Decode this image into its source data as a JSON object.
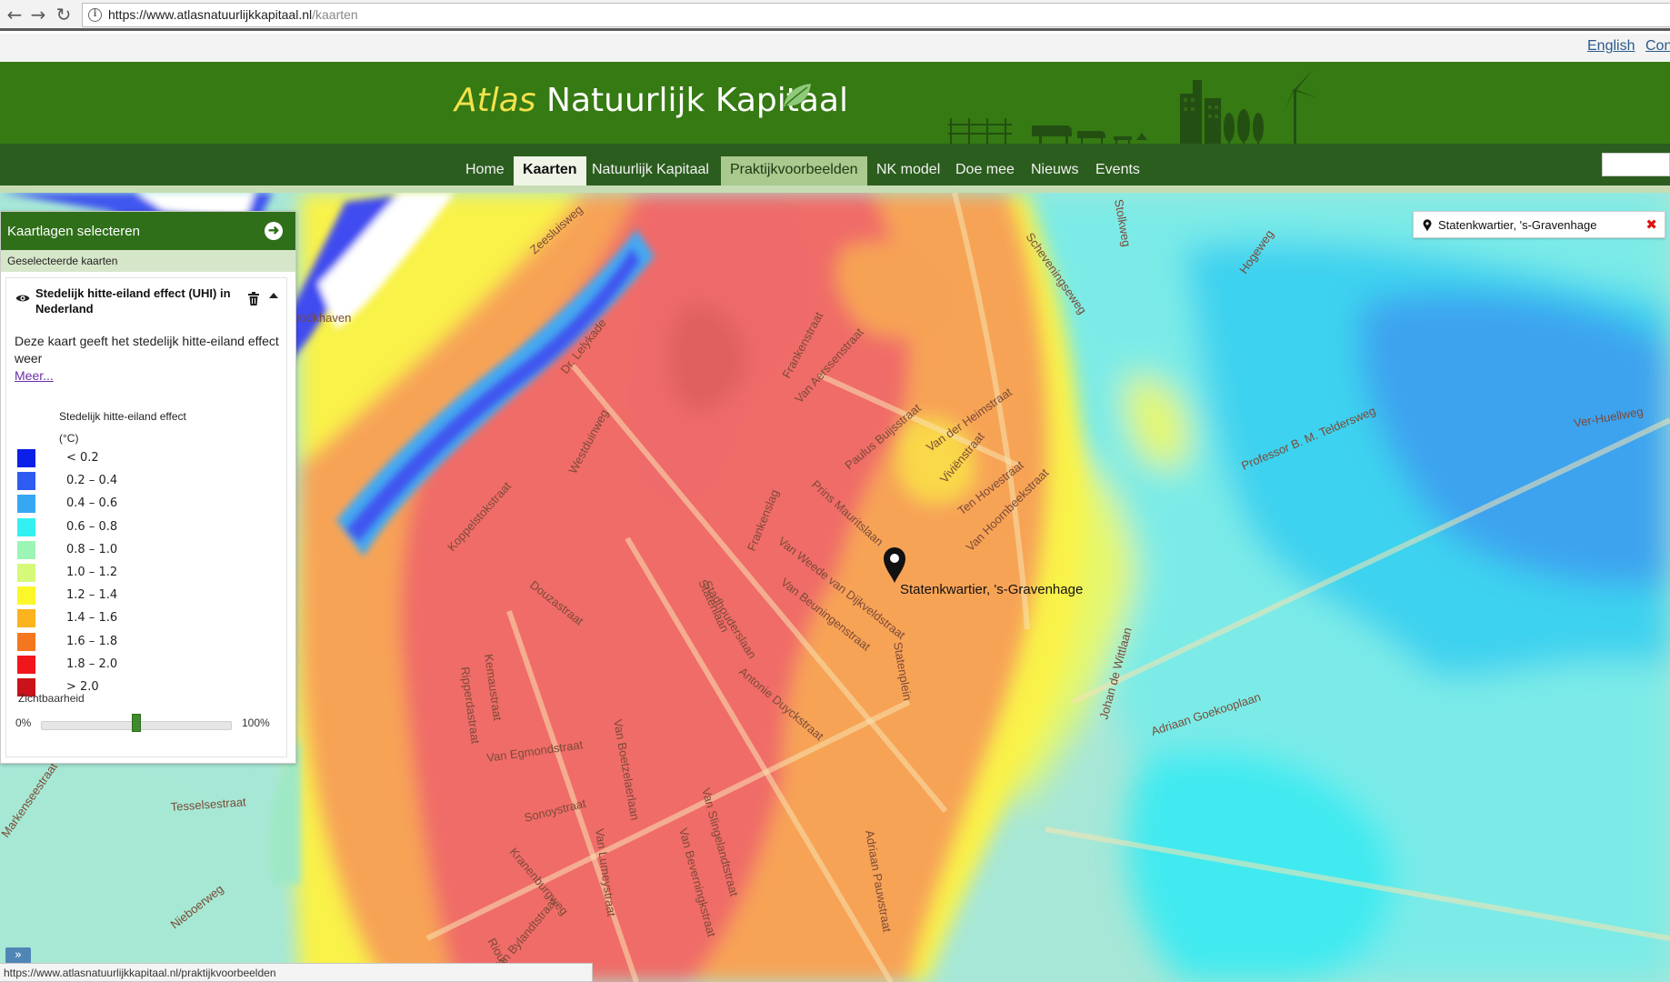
{
  "browser": {
    "back_icon": "arrow-left-icon",
    "forward_icon": "arrow-right-icon",
    "reload_icon": "reload-icon",
    "url_host": "https://www.atlasnatuurlijkkapitaal.nl",
    "url_path": "/kaarten"
  },
  "toplinks": {
    "english": "English",
    "contact": "Con"
  },
  "header": {
    "logo_atlas": "Atlas",
    "logo_rest": "Natuurlijk Kapitaal",
    "brand_color": "#357a12",
    "accent_color": "#f3e24c"
  },
  "nav": {
    "items": [
      {
        "label": "Home"
      },
      {
        "label": "Kaarten"
      },
      {
        "label": "Natuurlijk Kapitaal"
      },
      {
        "label": "Praktijkvoorbeelden"
      },
      {
        "label": "NK model"
      },
      {
        "label": "Doe mee"
      },
      {
        "label": "Nieuws"
      },
      {
        "label": "Events"
      }
    ],
    "active": "Kaarten",
    "hovered": "Praktijkvoorbeelden"
  },
  "panel": {
    "header": "Kaartlagen selecteren",
    "subheader": "Geselecteerde kaarten",
    "layer": {
      "title": "Stedelijk hitte-eiland effect (UHI) in Nederland",
      "description": "Deze kaart geeft het stedelijk hitte-eiland effect weer",
      "more_link": "Meer...",
      "legend_title": "Stedelijk hitte-eiland effect",
      "legend_unit": "(°C)",
      "legend": [
        {
          "label": "< 0.2",
          "color": "#0a1fe8"
        },
        {
          "label": "0.2 – 0.4",
          "color": "#2f5cf0"
        },
        {
          "label": "0.4 – 0.6",
          "color": "#37a7f3"
        },
        {
          "label": "0.6 – 0.8",
          "color": "#35f0f0"
        },
        {
          "label": "0.8 – 1.0",
          "color": "#9cf5b5"
        },
        {
          "label": "1.0 – 1.2",
          "color": "#d6f97a"
        },
        {
          "label": "1.2 – 1.4",
          "color": "#fbf72a"
        },
        {
          "label": "1.4 – 1.6",
          "color": "#fbb31f"
        },
        {
          "label": "1.6 – 1.8",
          "color": "#f4771f"
        },
        {
          "label": "1.8 – 2.0",
          "color": "#f0161b"
        },
        {
          "label": "> 2.0",
          "color": "#c9121a"
        }
      ],
      "visibility_label": "Zichtbaarheid",
      "visibility_min": "0%",
      "visibility_max": "100%",
      "visibility_value": 0.5
    }
  },
  "location": {
    "text": "Statenkwartier, 's-Gravenhage"
  },
  "map": {
    "marker_label": "Statenkwartier, 's-Gravenhage",
    "streets": [
      {
        "name": "Zeesluisweg"
      },
      {
        "name": "Dr. Lelykade"
      },
      {
        "name": "Westduinweg"
      },
      {
        "name": "Koppelstokstraat"
      },
      {
        "name": "Douzastraat"
      },
      {
        "name": "Frankenstraat"
      },
      {
        "name": "Van Aerssenstraat"
      },
      {
        "name": "Paulus Buijsstraat"
      },
      {
        "name": "Van der Heimstraat"
      },
      {
        "name": "Viviënstraat"
      },
      {
        "name": "Ten Hovestraat"
      },
      {
        "name": "Van Hoornbeekstraat"
      },
      {
        "name": "Van Beuningenstraat"
      },
      {
        "name": "Van Weede van Dijkveldstraat"
      },
      {
        "name": "Antonie Duyckstraat"
      },
      {
        "name": "Prins Mauritslaan"
      },
      {
        "name": "Frankenslag"
      },
      {
        "name": "Stadhouderslaan"
      },
      {
        "name": "Scheveningseweg"
      },
      {
        "name": "Stolkweg"
      },
      {
        "name": "Hogeweg"
      },
      {
        "name": "Professor B. M. Teldersweg"
      },
      {
        "name": "Ver-Huellweg"
      },
      {
        "name": "Adriaan Goekooplaan"
      },
      {
        "name": "Johan de Wittlaan"
      },
      {
        "name": "Van Egmondstraat"
      },
      {
        "name": "Sonoystraat"
      },
      {
        "name": "Van Slingelandtstraat"
      },
      {
        "name": "Adriaan Pauwstraat"
      },
      {
        "name": "Tesselsestraat"
      },
      {
        "name": "Nieboerweg"
      },
      {
        "name": "Kranenburgweg"
      },
      {
        "name": "Riouwstraat"
      },
      {
        "name": "Van Lumeystraat"
      },
      {
        "name": "Van Bylandtstraat"
      },
      {
        "name": "Kemaustraat"
      },
      {
        "name": "Ripperdastraat"
      },
      {
        "name": "Van Beverningkstraat"
      },
      {
        "name": "Statenlaan"
      },
      {
        "name": "Van Boetzelaerlaan"
      },
      {
        "name": "Vodkhaven"
      },
      {
        "name": "Markenseestraat"
      },
      {
        "name": "Statenplein"
      }
    ]
  },
  "status": {
    "url": "https://www.atlasnatuurlijkkapitaal.nl/praktijkvoorbeelden"
  }
}
